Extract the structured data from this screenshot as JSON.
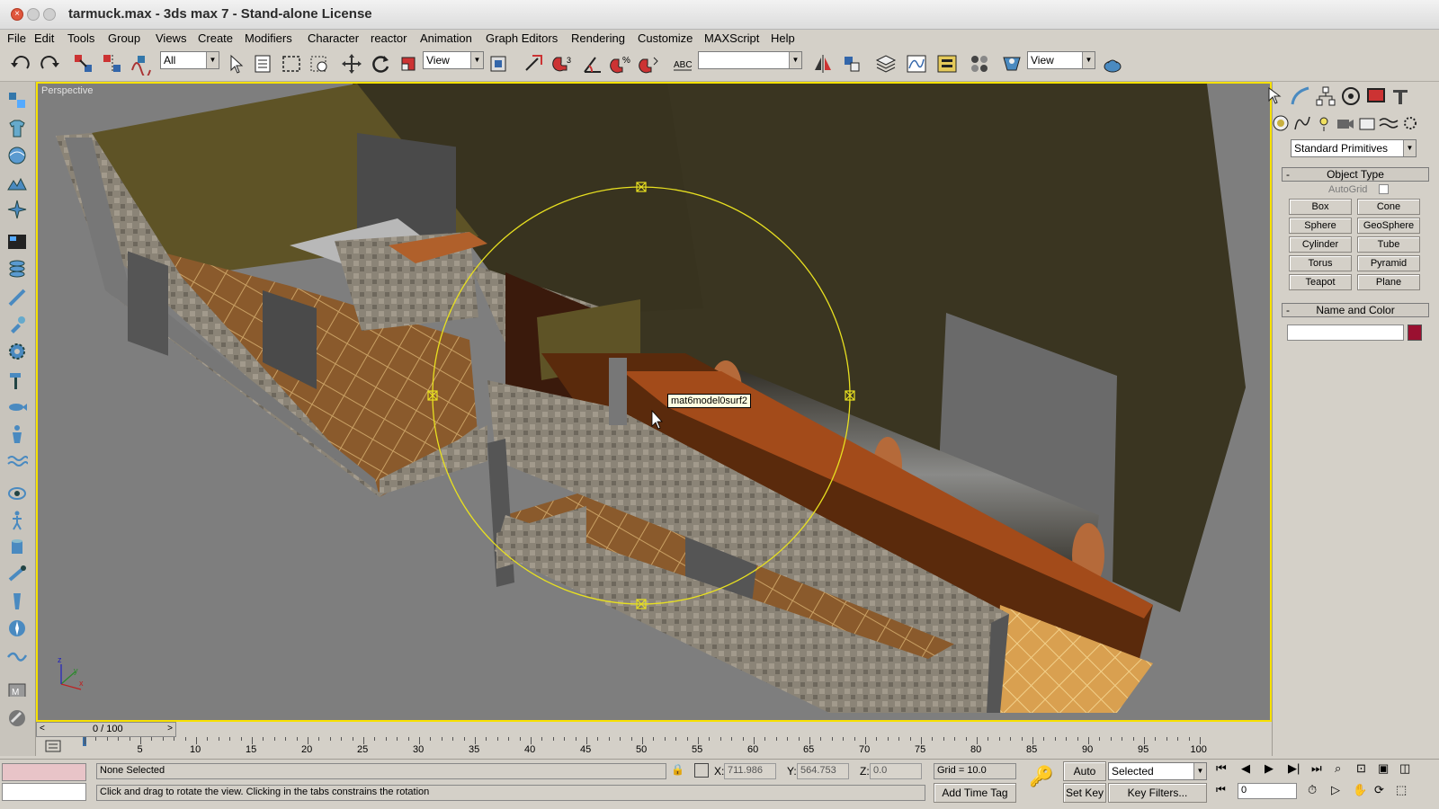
{
  "window": {
    "title": "tarmuck.max - 3ds max 7  - Stand-alone License"
  },
  "menu": [
    "File",
    "Edit",
    "Tools",
    "Group",
    "Views",
    "Create",
    "Modifiers",
    "Character",
    "reactor",
    "Animation",
    "Graph Editors",
    "Rendering",
    "Customize",
    "MAXScript",
    "Help"
  ],
  "toolbar": {
    "selection_filter": "All",
    "ref_coord_1": "View",
    "named_selection": "",
    "ref_coord_2": "View",
    "icons": [
      "undo-icon",
      "redo-icon",
      "select-link-icon",
      "unlink-icon",
      "bind-spacewarp-icon",
      "select-object-icon",
      "select-by-name-icon",
      "rect-selection-icon",
      "window-crossing-icon",
      "move-icon",
      "rotate-icon",
      "scale-icon",
      "pivot-icon",
      "manipulate-icon",
      "snap-3d-icon",
      "angle-snap-icon",
      "percent-snap-icon",
      "spinner-snap-icon",
      "edit-named-sel-icon",
      "mirror-icon",
      "align-icon",
      "layer-manager-icon",
      "curve-editor-icon",
      "schematic-view-icon",
      "material-editor-icon",
      "render-scene-icon",
      "quick-render-icon"
    ]
  },
  "viewport": {
    "label": "Perspective",
    "tooltip": "mat6model0surf2",
    "axis": {
      "x": "x",
      "y": "y",
      "z": "z"
    }
  },
  "command_panel": {
    "category": "Standard Primitives",
    "object_type_title": "Object Type",
    "autogrid": "AutoGrid",
    "buttons": [
      [
        "Box",
        "Cone"
      ],
      [
        "Sphere",
        "GeoSphere"
      ],
      [
        "Cylinder",
        "Tube"
      ],
      [
        "Torus",
        "Pyramid"
      ],
      [
        "Teapot",
        "Plane"
      ]
    ],
    "name_color_title": "Name and Color",
    "object_name": "",
    "object_color": "#9a1030"
  },
  "timeline": {
    "position": "0 / 100",
    "ticks": [
      "5",
      "10",
      "15",
      "20",
      "25",
      "30",
      "35",
      "40",
      "45",
      "50",
      "55",
      "60",
      "65",
      "70",
      "75",
      "80",
      "85",
      "90",
      "95",
      "100"
    ]
  },
  "status": {
    "selection": "None Selected",
    "x_label": "X:",
    "x_value": "711.986",
    "y_label": "Y:",
    "y_value": "564.753",
    "z_label": "Z:",
    "z_value": "0.0",
    "grid": "Grid = 10.0",
    "prompt": "Click and drag to rotate the view.  Clicking in the tabs constrains the rotation",
    "add_time_tag": "Add Time Tag",
    "auto_key": "Auto Key",
    "set_key": "Set Key",
    "selected_option": "Selected",
    "key_filters": "Key Filters...",
    "frame": "0"
  }
}
